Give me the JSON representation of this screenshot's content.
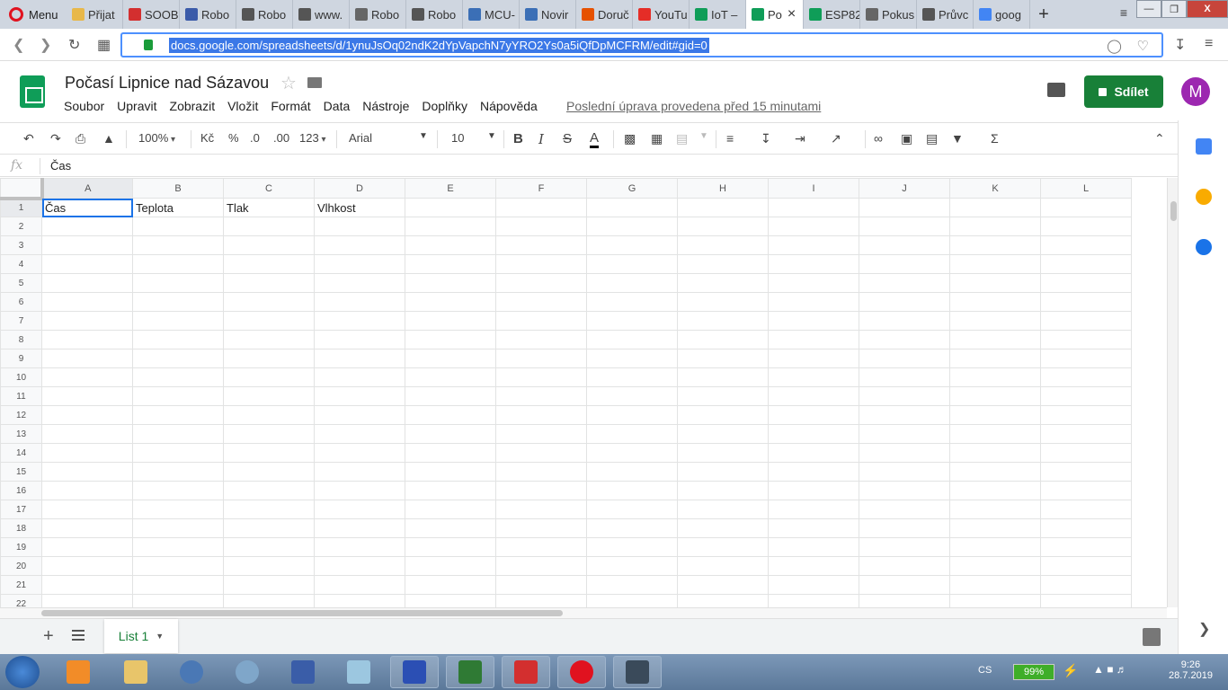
{
  "browser": {
    "menu_label": "Menu",
    "tabs": [
      {
        "label": "Přijat",
        "color": "#e8b84a"
      },
      {
        "label": "SOOB",
        "color": "#d32f2f"
      },
      {
        "label": "Robo",
        "color": "#3b5ba9"
      },
      {
        "label": "Robo",
        "color": "#555555"
      },
      {
        "label": "www.",
        "color": "#555555"
      },
      {
        "label": "Robo",
        "color": "#666666"
      },
      {
        "label": "Robo",
        "color": "#555555"
      },
      {
        "label": "MCU-",
        "color": "#3b6fb6"
      },
      {
        "label": "Novir",
        "color": "#3b6fb6"
      },
      {
        "label": "Doruč",
        "color": "#e65100"
      },
      {
        "label": "YouTu",
        "color": "#e52d27"
      },
      {
        "label": "IoT –",
        "color": "#0f9d58"
      },
      {
        "label": "Po",
        "color": "#0f9d58",
        "active": true
      },
      {
        "label": "ESP82",
        "color": "#0f9d58"
      },
      {
        "label": "Pokus",
        "color": "#666666"
      },
      {
        "label": "Průvc",
        "color": "#555555"
      },
      {
        "label": "goog",
        "color": "#4285f4"
      }
    ],
    "url": "docs.google.com/spreadsheets/d/1ynuJsOq02ndK2dYpVapchN7yYRO2Ys0a5iQfDpMCFRM/edit#gid=0"
  },
  "doc": {
    "title": "Počasí Lipnice nad Sázavou",
    "menu": [
      "Soubor",
      "Upravit",
      "Zobrazit",
      "Vložit",
      "Formát",
      "Data",
      "Nástroje",
      "Doplňky",
      "Nápověda"
    ],
    "last_edit": "Poslední úprava provedena před 15 minutami",
    "share_label": "Sdílet",
    "avatar_letter": "M",
    "accent": "#188038"
  },
  "toolbar": {
    "zoom": "100%",
    "currency": "Kč",
    "percent": "%",
    "dec_less": ".0",
    "dec_more": ".00",
    "format_more": "123",
    "font": "Arial",
    "font_size": "10"
  },
  "formula": {
    "fx": "fx",
    "value": "Čas"
  },
  "grid": {
    "columns": [
      "A",
      "B",
      "C",
      "D",
      "E",
      "F",
      "G",
      "H",
      "I",
      "J",
      "K",
      "L"
    ],
    "rows": [
      "1",
      "2",
      "3",
      "4",
      "5",
      "6",
      "7",
      "8",
      "9",
      "10",
      "11",
      "12",
      "13",
      "14",
      "15",
      "16",
      "17",
      "18",
      "19",
      "20",
      "21",
      "22"
    ],
    "cells": {
      "1": [
        "Čas",
        "Teplota",
        "Tlak",
        "Vlhkost"
      ]
    },
    "selected": "A1"
  },
  "sheets": {
    "active_tab": "List 1"
  },
  "taskbar": {
    "language": "CS",
    "battery": "99%",
    "time": "9:26",
    "date": "28.7.2019"
  }
}
